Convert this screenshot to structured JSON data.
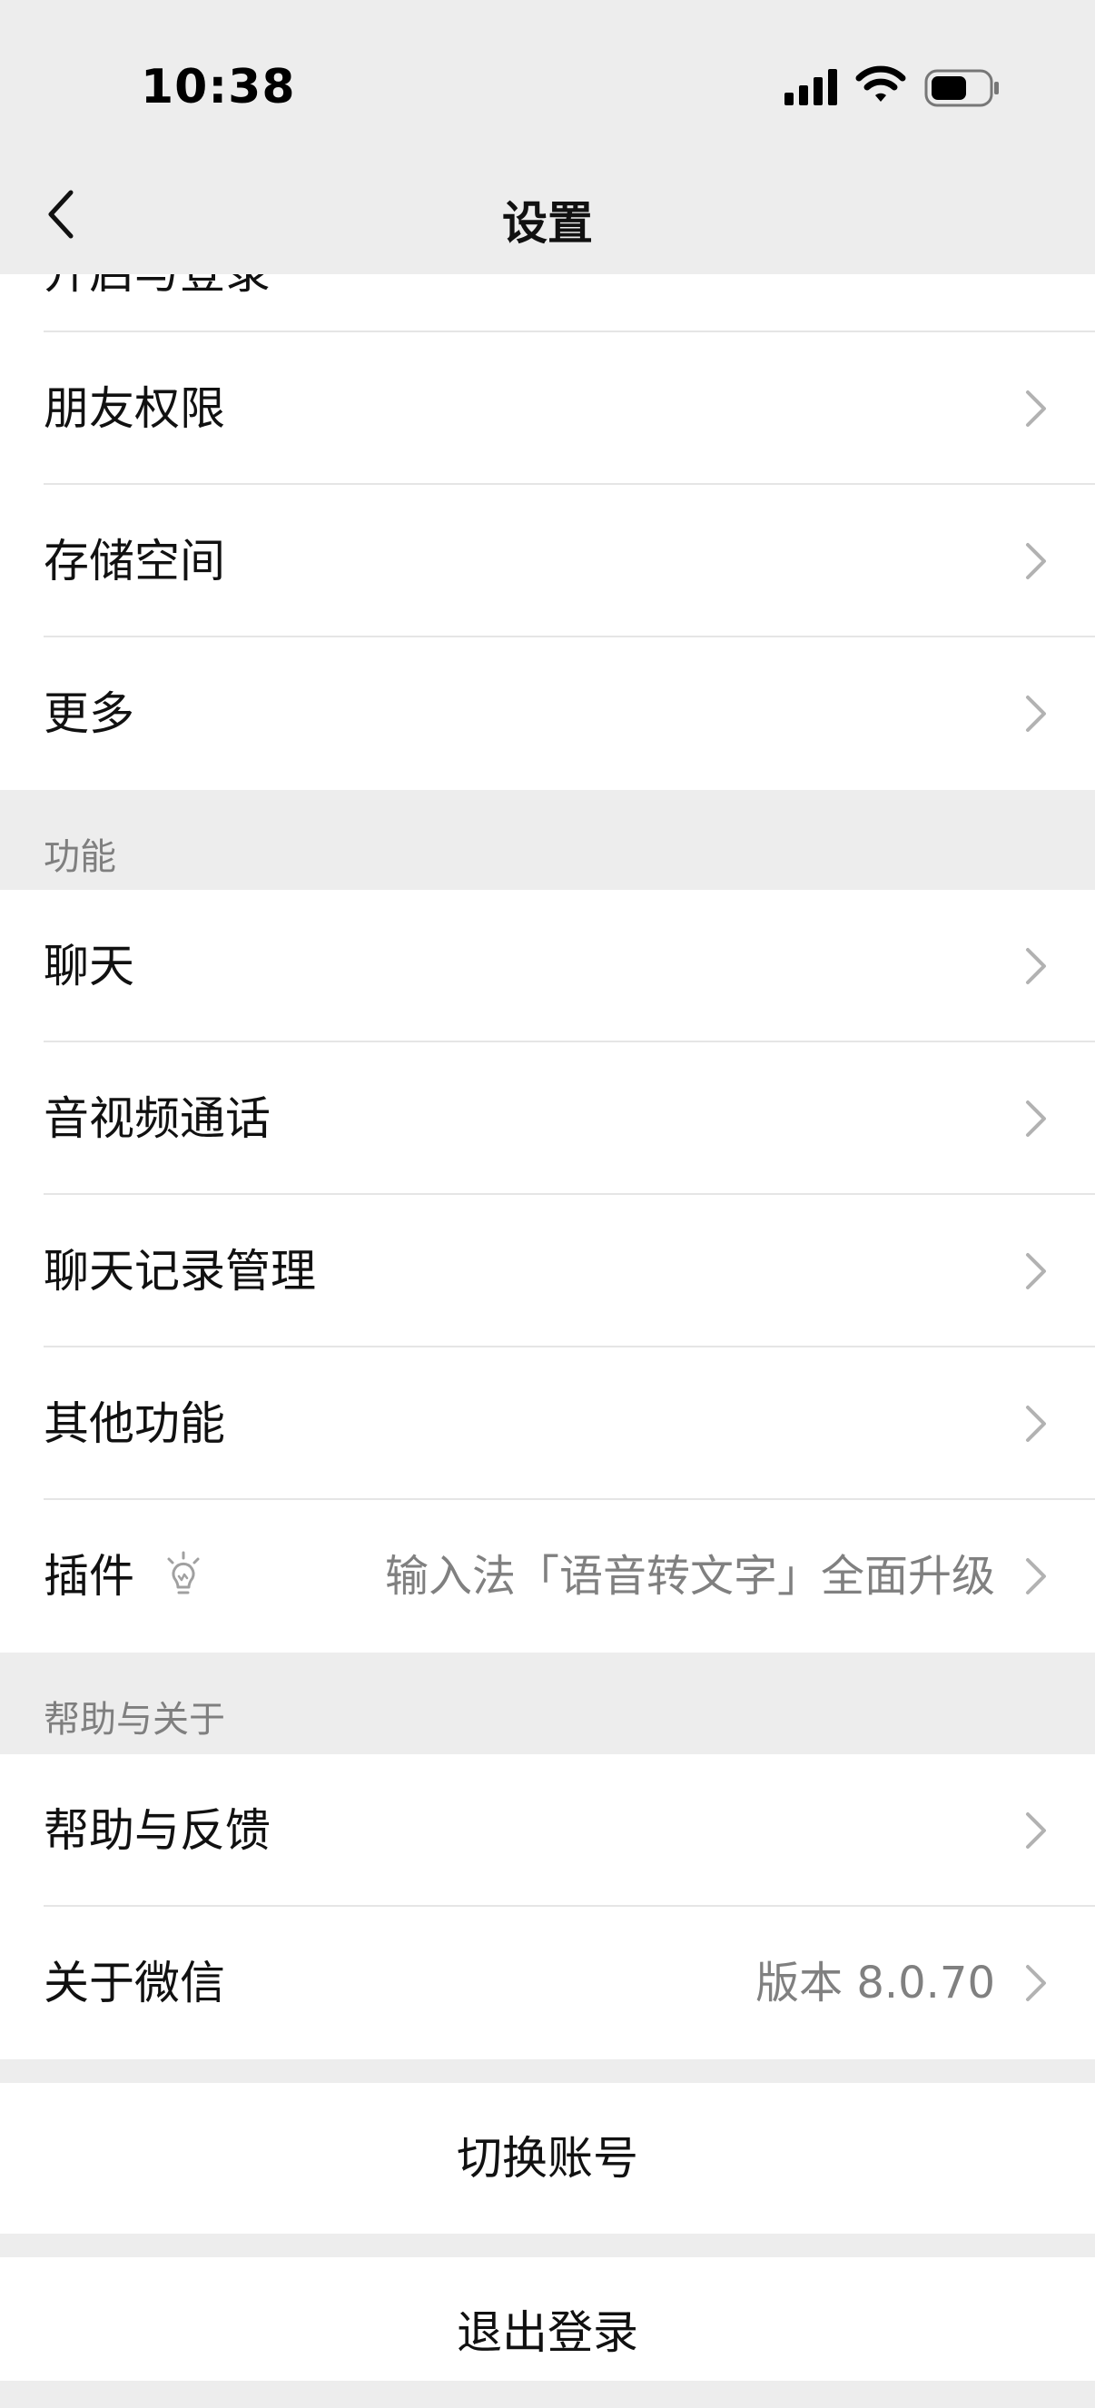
{
  "status_bar": {
    "time": "10:38"
  },
  "nav": {
    "title": "设置"
  },
  "group1": {
    "partial_label": "开启与登录",
    "items": [
      {
        "label": "朋友权限"
      },
      {
        "label": "存储空间"
      },
      {
        "label": "更多"
      }
    ]
  },
  "section_function": {
    "header": "功能",
    "items": [
      {
        "label": "聊天"
      },
      {
        "label": "音视频通话"
      },
      {
        "label": "聊天记录管理"
      },
      {
        "label": "其他功能"
      },
      {
        "label": "插件",
        "value": "输入法「语音转文字」全面升级"
      }
    ]
  },
  "section_help": {
    "header": "帮助与关于",
    "items": [
      {
        "label": "帮助与反馈"
      },
      {
        "label": "关于微信",
        "value": "版本 8.0.70"
      }
    ]
  },
  "actions": {
    "switch_account": "切换账号",
    "logout": "退出登录"
  },
  "icons": {
    "back": "chevron-left-icon",
    "chevron": "chevron-right-icon",
    "plugin": "lightbulb-icon",
    "signal": "cellular-signal-icon",
    "wifi": "wifi-icon",
    "battery": "battery-icon"
  },
  "colors": {
    "background": "#ededed",
    "card": "#ffffff",
    "text": "#111111",
    "secondary_text": "#808080"
  }
}
